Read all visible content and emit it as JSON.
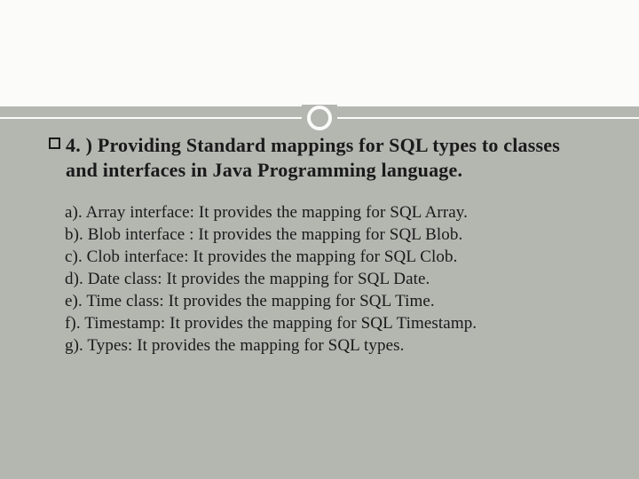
{
  "slide": {
    "heading": "4. ) Providing Standard mappings for SQL types to classes and interfaces in Java Programming language.",
    "items": [
      "a). Array interface: It provides the mapping for SQL Array.",
      "b). Blob interface : It provides the mapping for SQL Blob.",
      "c). Clob interface: It provides the mapping for SQL Clob.",
      "d). Date class: It provides the mapping for SQL Date.",
      "e). Time class: It provides the mapping for SQL Time.",
      "f). Timestamp: It provides the mapping for SQL Timestamp.",
      "g). Types: It provides the mapping for SQL types."
    ]
  }
}
